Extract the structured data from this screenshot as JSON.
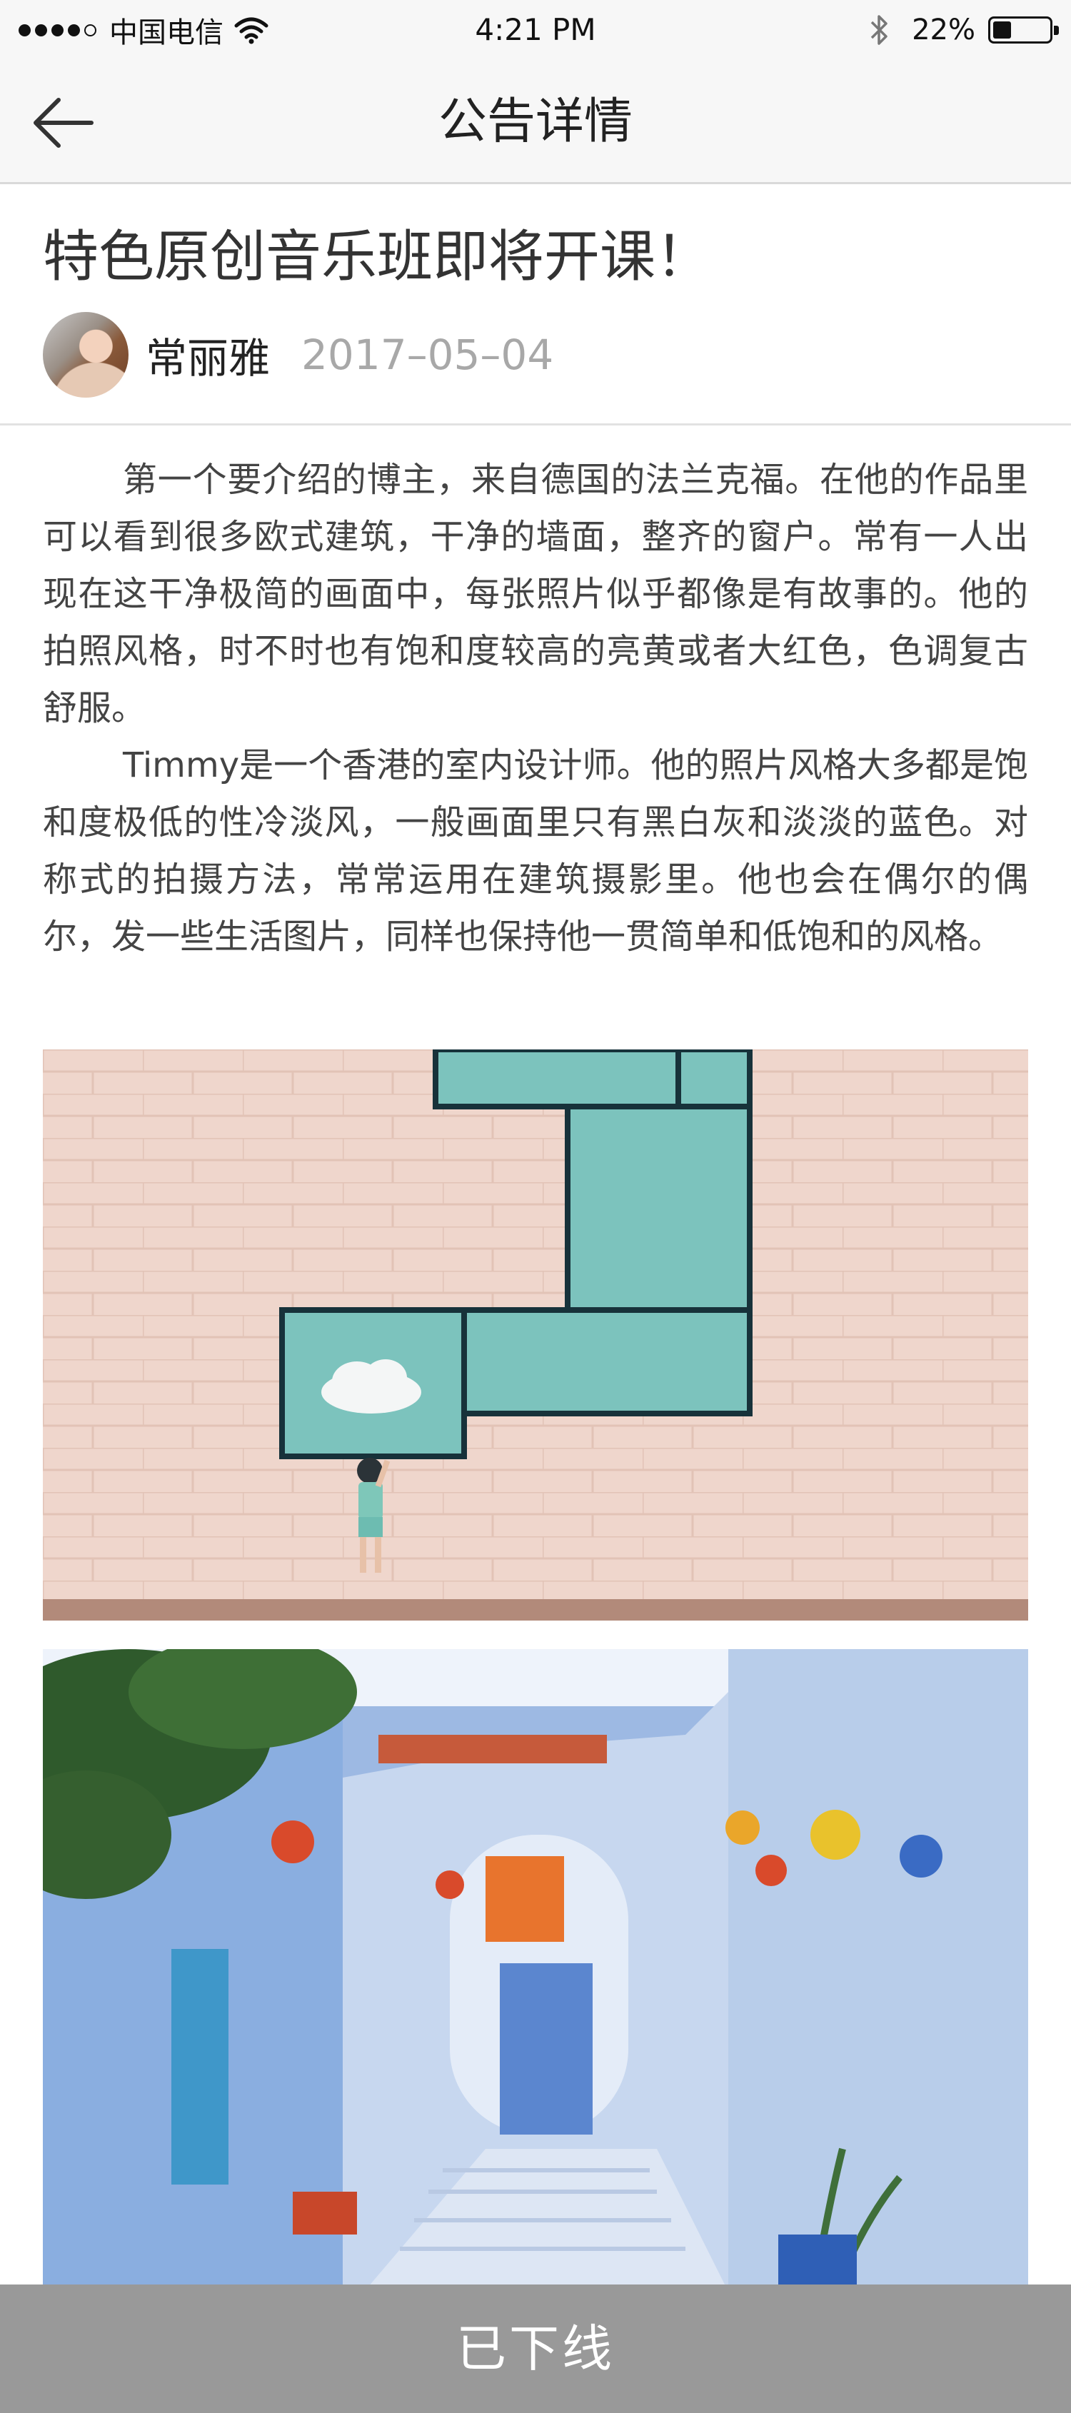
{
  "status_bar": {
    "carrier": "中国电信",
    "time": "4:21 PM",
    "battery_percent": "22%",
    "battery_level": 0.22,
    "signal_bars": 4,
    "icons": [
      "signal-dots-icon",
      "wifi-icon",
      "bluetooth-icon",
      "battery-icon"
    ]
  },
  "nav": {
    "title": "公告详情",
    "back_icon": "back-arrow-icon"
  },
  "article": {
    "title": "特色原创音乐班即将开课！",
    "author": "常丽雅",
    "date": "2017–05–04",
    "paragraphs": [
      "第一个要介绍的博主，来自德国的法兰克福。在他的作品里可以看到很多欧式建筑，干净的墙面，整齐的窗户。常有一人出现在这干净极简的画面中，每张照片似乎都像是有故事的。他的拍照风格，时不时也有饱和度较高的亮黄或者大红色，色调复古舒服。",
      "Timmy是一个香港的室内设计师。他的照片风格大多都是饱和度极低的性冷淡风，一般画面里只有黑白灰和淡淡的蓝色。对称式的拍摄方法，常常运用在建筑摄影里。他也会在偶尔的偶尔，发一些生活图片，同样也保持他一贯简单和低饱和的风格。"
    ]
  },
  "bottom_bar": {
    "label": "已下线"
  },
  "colors": {
    "nav_background": "#f7f7f7",
    "bottom_bar": "#999999",
    "date_text": "#a8a8a8"
  }
}
